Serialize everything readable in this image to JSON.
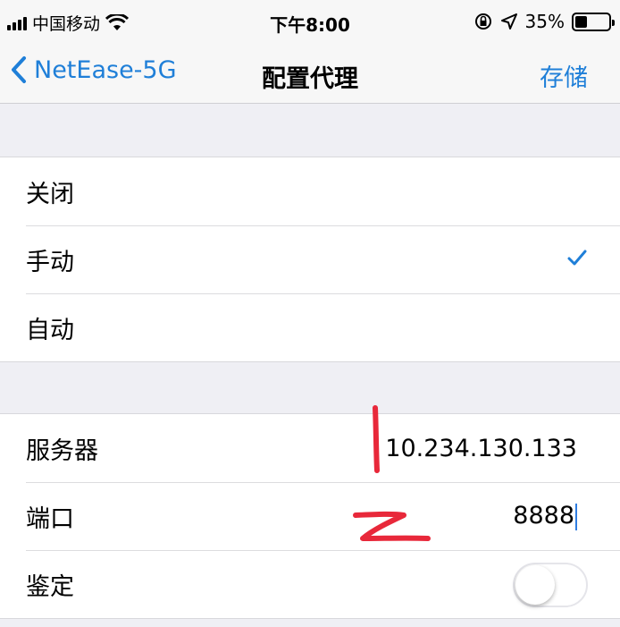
{
  "status_bar": {
    "carrier": "中国移动",
    "time": "下午8:00",
    "battery_percent": "35%",
    "battery_level": 0.35,
    "icons": [
      "signal-icon",
      "wifi-icon",
      "orientation-lock-icon",
      "location-icon",
      "battery-icon"
    ]
  },
  "nav": {
    "back_label": "NetEase-5G",
    "title": "配置代理",
    "save_label": "存储"
  },
  "proxy_modes": [
    {
      "label": "关闭",
      "selected": false
    },
    {
      "label": "手动",
      "selected": true
    },
    {
      "label": "自动",
      "selected": false
    }
  ],
  "manual_settings": {
    "server_label": "服务器",
    "server_value": "10.234.130.133",
    "port_label": "端口",
    "port_value": "8888",
    "auth_label": "鉴定",
    "auth_enabled": false
  },
  "colors": {
    "accent": "#1f7fd8",
    "annotation": "#e8283a",
    "background": "#efeff4"
  }
}
